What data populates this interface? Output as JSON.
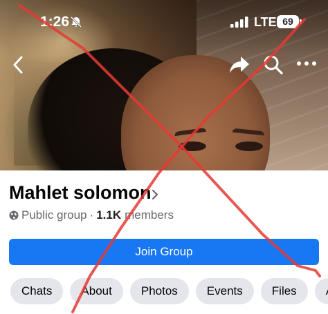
{
  "status_bar": {
    "time": "1:26",
    "network": "LTE",
    "battery": "69"
  },
  "icons": {
    "back": "chevron-left-icon",
    "share": "share-icon",
    "search": "search-icon",
    "more": "more-horizontal-icon",
    "mute": "bell-slash-icon",
    "globe": "globe-icon"
  },
  "group": {
    "name": "Mahlet solomon",
    "privacy": "Public group",
    "separator": "·",
    "member_count": "1.1K",
    "member_label": "members"
  },
  "join_button": {
    "label": "Join Group"
  },
  "tabs": [
    {
      "label": "Chats"
    },
    {
      "label": "About"
    },
    {
      "label": "Photos"
    },
    {
      "label": "Events"
    },
    {
      "label": "Files"
    },
    {
      "label": "Alb"
    }
  ],
  "colors": {
    "accent": "#1877f2",
    "overlay_cross": "#e53935"
  }
}
